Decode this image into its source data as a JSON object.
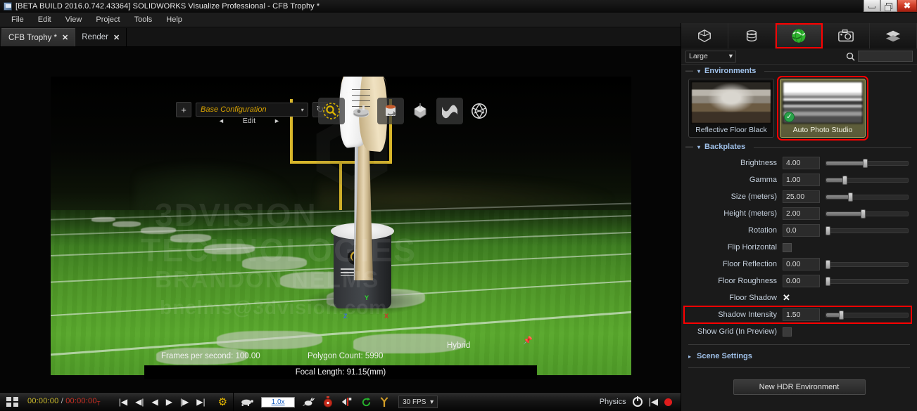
{
  "window": {
    "title": "[BETA BUILD 2016.0.742.43364] SOLIDWORKS Visualize Professional - CFB Trophy *",
    "app_icon": "solidworks-icon",
    "minimize_label": "Minimize",
    "maximize_label": "Maximize",
    "close_label": "✖"
  },
  "menubar": {
    "items": [
      "File",
      "Edit",
      "View",
      "Project",
      "Tools",
      "Help"
    ]
  },
  "tabs": [
    {
      "label": "CFB Trophy *",
      "close": "✕",
      "active": true
    },
    {
      "label": "Render",
      "close": "✕",
      "active": false
    }
  ],
  "viewport": {
    "add_button": "+",
    "configuration": {
      "value": "Base Configuration",
      "caret": "▾"
    },
    "refresh_icon": "refresh-icon",
    "edit_row": {
      "prev": "◄",
      "label": "Edit",
      "next": "►"
    },
    "tools": [
      {
        "name": "magnifier-select-icon"
      },
      {
        "name": "turntable-icon"
      },
      {
        "name": "cylinder-rotate-icon"
      },
      {
        "name": "cube-gizmo-icon"
      },
      {
        "name": "camera-flip-icon"
      },
      {
        "name": "aperture-icon"
      }
    ],
    "watermark": {
      "line1": "3DVISION",
      "line2": "TECHNOLOGIES",
      "line3": "BRANDON NELMS",
      "line4": "bnelms@3dvision.com"
    },
    "axes": {
      "x": "X",
      "y": "Y",
      "z": "Z"
    },
    "stats": {
      "fps": "Frames per second: 100.00",
      "polygons": "Polygon Count: 5990",
      "mode": "Hybrid",
      "focal": "Focal Length: 91.15(mm)",
      "pin_icon": "pin-icon"
    }
  },
  "right_panel": {
    "tabs": [
      {
        "name": "models-tab",
        "icon": "cube-icon",
        "selected": false
      },
      {
        "name": "appearances-tab",
        "icon": "database-icon",
        "selected": false
      },
      {
        "name": "environments-tab",
        "icon": "globe-icon",
        "selected": true,
        "highlighted": true
      },
      {
        "name": "cameras-tab",
        "icon": "camera-icon",
        "selected": false
      },
      {
        "name": "models-layers-tab",
        "icon": "layers-icon",
        "selected": false
      }
    ],
    "toolbar": {
      "size_value": "Large",
      "size_caret": "▾",
      "search_icon": "search-icon",
      "search_value": "",
      "search_placeholder": ""
    },
    "environments_section": {
      "title": "Environments",
      "caret": "▾",
      "dash": "—",
      "items": [
        {
          "name": "Reflective Floor Black",
          "selected": false,
          "thumb": "reflective"
        },
        {
          "name": "Auto Photo Studio",
          "selected": true,
          "highlighted": true,
          "thumb": "studio",
          "check": "✓"
        }
      ]
    },
    "backplates_section": {
      "title": "Backplates",
      "caret": "▾",
      "dash": "—"
    },
    "properties": [
      {
        "label": "Brightness",
        "value": "4.00",
        "type": "slider",
        "pct": 45
      },
      {
        "label": "Gamma",
        "value": "1.00",
        "type": "slider",
        "pct": 20
      },
      {
        "label": "Size (meters)",
        "value": "25.00",
        "type": "slider",
        "pct": 27
      },
      {
        "label": "Height (meters)",
        "value": "2.00",
        "type": "slider",
        "pct": 42
      },
      {
        "label": "Rotation",
        "value": "0.0",
        "type": "slider",
        "pct": 1
      },
      {
        "label": "Flip Horizontal",
        "value": "",
        "type": "checkbox",
        "checked": false
      },
      {
        "label": "Floor Reflection",
        "value": "0.00",
        "type": "slider",
        "pct": 1
      },
      {
        "label": "Floor Roughness",
        "value": "0.00",
        "type": "slider",
        "pct": 1
      },
      {
        "label": "Floor Shadow",
        "value": "✕",
        "type": "xcheck",
        "checked": true
      },
      {
        "label": "Shadow Intensity",
        "value": "1.50",
        "type": "slider",
        "pct": 16,
        "highlighted": true
      },
      {
        "label": "Show Grid (In Preview)",
        "value": "",
        "type": "checkbox",
        "checked": false
      }
    ],
    "scene_settings": {
      "title": "Scene Settings",
      "caret": "▸"
    },
    "new_hdr_button": "New HDR Environment"
  },
  "bottom_bar": {
    "grid_icon": "grid-view-icon",
    "timecode": {
      "current": "00:00:00",
      "separator": "/",
      "total": "00:00:00",
      "suffix": "T"
    },
    "transport": [
      {
        "name": "skip-start-button",
        "glyph": "|◀"
      },
      {
        "name": "step-back-button",
        "glyph": "◀|"
      },
      {
        "name": "play-reverse-button",
        "glyph": "◀"
      },
      {
        "name": "play-button",
        "glyph": "▶"
      },
      {
        "name": "step-forward-button",
        "glyph": "|▶"
      },
      {
        "name": "skip-end-button",
        "glyph": "▶|"
      }
    ],
    "settings_icon": "gear-icon",
    "slow_icon": "turtle-icon",
    "speed_value": "1.0x",
    "fast_icon": "rabbit-icon",
    "timer_icon": "stopwatch-icon",
    "keyframe_prev_icon": "keyframe-left-icon",
    "loop_icon": "loop-icon",
    "tuning-fork_icon": "keyframe-icon",
    "fps_value": "30 FPS",
    "fps_caret": "▾",
    "physics_label": "Physics",
    "power_icon": "power-icon",
    "rewind_icon": "rewind-icon",
    "record_icon": "record-icon"
  }
}
